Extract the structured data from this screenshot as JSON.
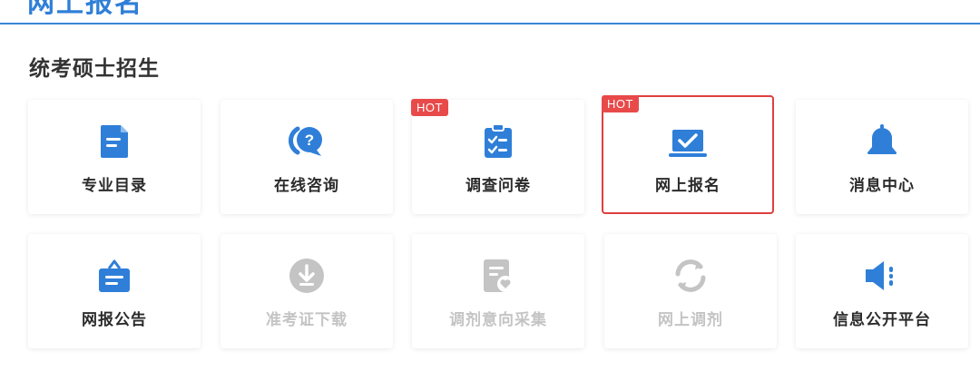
{
  "header": {
    "partial_title": "网上报名"
  },
  "section": {
    "title": "统考硕士招生"
  },
  "colors": {
    "accent": "#2f7fd8",
    "hot_badge": "#e84a4a",
    "active_border": "#e03f3f",
    "disabled": "#c4c4c4"
  },
  "cards": [
    {
      "label": "专业目录",
      "icon": "document-icon",
      "hot": "",
      "state": "normal"
    },
    {
      "label": "在线咨询",
      "icon": "question-chat-icon",
      "hot": "",
      "state": "normal"
    },
    {
      "label": "调查问卷",
      "icon": "clipboard-checklist-icon",
      "hot": "HOT",
      "state": "normal"
    },
    {
      "label": "网上报名",
      "icon": "laptop-check-icon",
      "hot": "HOT",
      "state": "selected"
    },
    {
      "label": "消息中心",
      "icon": "bell-icon",
      "hot": "",
      "state": "normal"
    },
    {
      "label": "网报公告",
      "icon": "notice-board-icon",
      "hot": "",
      "state": "normal"
    },
    {
      "label": "准考证下载",
      "icon": "download-icon",
      "hot": "",
      "state": "disabled"
    },
    {
      "label": "调剂意向采集",
      "icon": "form-heart-icon",
      "hot": "",
      "state": "disabled"
    },
    {
      "label": "网上调剂",
      "icon": "refresh-icon",
      "hot": "",
      "state": "disabled"
    },
    {
      "label": "信息公开平台",
      "icon": "speaker-icon",
      "hot": "",
      "state": "normal"
    }
  ]
}
